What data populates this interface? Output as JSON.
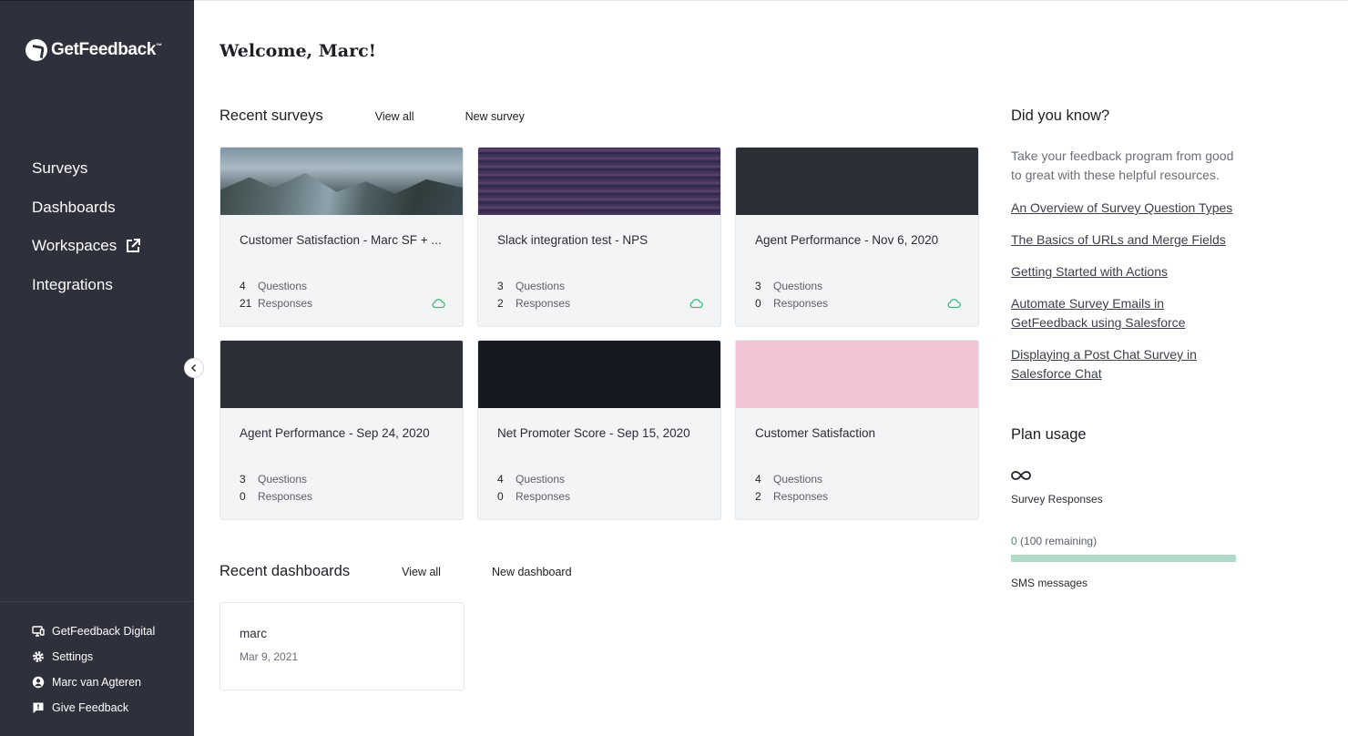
{
  "brand": {
    "name": "GetFeedback",
    "tm": "™"
  },
  "sidebar": {
    "nav": [
      {
        "label": "Surveys"
      },
      {
        "label": "Dashboards"
      },
      {
        "label": "Workspaces",
        "icon": "external-link-icon"
      },
      {
        "label": "Integrations"
      }
    ],
    "bottom": [
      {
        "label": "GetFeedback Digital",
        "icon": "monitor-icon"
      },
      {
        "label": "Settings",
        "icon": "gear-icon"
      },
      {
        "label": "Marc van Agteren",
        "icon": "user-circle-icon"
      },
      {
        "label": "Give Feedback",
        "icon": "chat-bubble-icon"
      }
    ]
  },
  "main": {
    "welcome": "Welcome, Marc!",
    "surveys": {
      "title": "Recent surveys",
      "view_all": "View all",
      "new": "New survey",
      "questions_label": "Questions",
      "responses_label": "Responses",
      "cards": [
        {
          "title": "Customer Satisfaction - Marc SF + ...",
          "questions": "4",
          "responses": "21",
          "synced": true,
          "image": "mountain landscape"
        },
        {
          "title": "Slack integration test - NPS",
          "questions": "3",
          "responses": "2",
          "synced": true,
          "image": "purple water"
        },
        {
          "title": "Agent Performance - Nov 6, 2020",
          "questions": "3",
          "responses": "0",
          "synced": true,
          "image": "dark gray"
        },
        {
          "title": "Agent Performance - Sep 24, 2020",
          "questions": "3",
          "responses": "0",
          "synced": false,
          "image": "dark gray"
        },
        {
          "title": "Net Promoter Score - Sep 15, 2020",
          "questions": "4",
          "responses": "0",
          "synced": false,
          "image": "near black"
        },
        {
          "title": "Customer Satisfaction",
          "questions": "4",
          "responses": "2",
          "synced": false,
          "image": "pink"
        }
      ]
    },
    "dashboards": {
      "title": "Recent dashboards",
      "view_all": "View all",
      "new": "New dashboard",
      "cards": [
        {
          "name": "marc",
          "date": "Mar 9, 2021"
        }
      ]
    }
  },
  "right": {
    "did_you_know": {
      "title": "Did you know?",
      "text": "Take your feedback program from good to great with these helpful resources.",
      "links": [
        "An Overview of Survey Question Types",
        "The Basics of URLs and Merge Fields",
        "Getting Started with Actions",
        "Automate Survey Emails in GetFeedback using Salesforce",
        "Displaying a Post Chat Survey in Salesforce Chat"
      ]
    },
    "plan": {
      "title": "Plan usage",
      "survey_responses_label": "Survey Responses",
      "survey_responses_limit_icon": "infinity-icon",
      "sms_used": "0",
      "sms_remaining": "(100 remaining)",
      "sms_used_fraction": 0,
      "sms_label": "SMS messages"
    }
  },
  "colors": {
    "sidebar_bg": "#2e313c",
    "accent_green": "#2f9b6b",
    "progress_track": "#b1dac8",
    "card_bg": "#f3f4f6"
  }
}
